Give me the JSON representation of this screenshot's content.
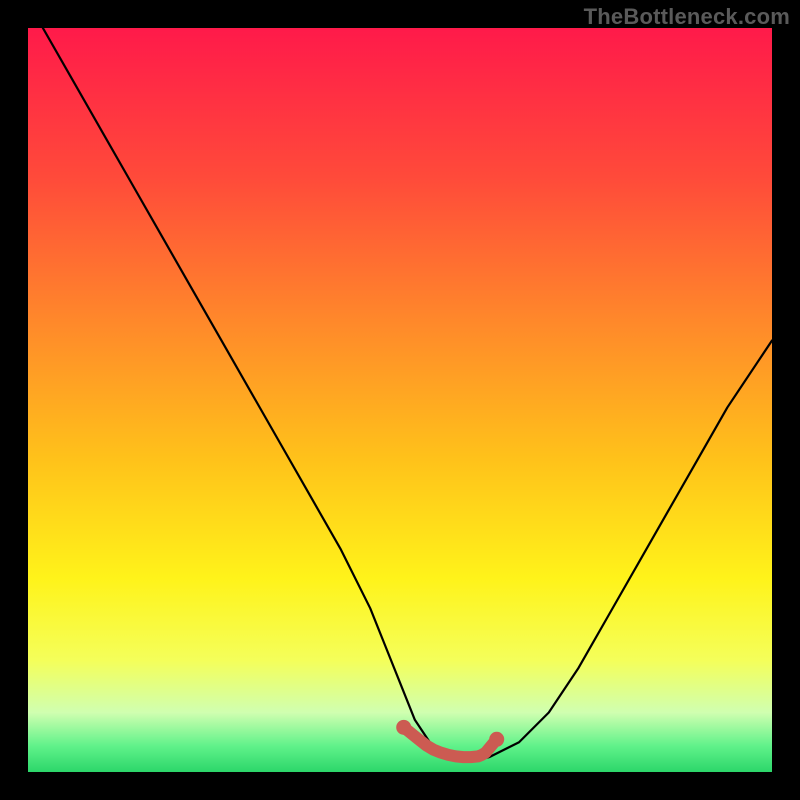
{
  "watermark": "TheBottleneck.com",
  "chart_data": {
    "type": "line",
    "title": "",
    "xlabel": "",
    "ylabel": "",
    "xlim": [
      0,
      100
    ],
    "ylim": [
      0,
      100
    ],
    "grid": false,
    "line_color": "#000000",
    "marker_color": "#cc5b52",
    "gradient_stops": [
      {
        "offset": 0.0,
        "color": "#ff1a4a"
      },
      {
        "offset": 0.2,
        "color": "#ff4a3a"
      },
      {
        "offset": 0.4,
        "color": "#ff8a2a"
      },
      {
        "offset": 0.58,
        "color": "#ffc21a"
      },
      {
        "offset": 0.74,
        "color": "#fff31a"
      },
      {
        "offset": 0.85,
        "color": "#f4ff5a"
      },
      {
        "offset": 0.92,
        "color": "#d0ffb0"
      },
      {
        "offset": 0.965,
        "color": "#60f28a"
      },
      {
        "offset": 1.0,
        "color": "#2cd66a"
      }
    ],
    "series": [
      {
        "name": "curve",
        "x": [
          2,
          6,
          10,
          14,
          18,
          22,
          26,
          30,
          34,
          38,
          42,
          46,
          50,
          52,
          54,
          56,
          58,
          60,
          62,
          66,
          70,
          74,
          78,
          82,
          86,
          90,
          94,
          98,
          100
        ],
        "y": [
          100,
          93,
          86,
          79,
          72,
          65,
          58,
          51,
          44,
          37,
          30,
          22,
          12,
          7,
          4,
          2,
          1.5,
          1.5,
          2,
          4,
          8,
          14,
          21,
          28,
          35,
          42,
          49,
          55,
          58
        ]
      }
    ],
    "flat_segment": {
      "x": [
        50.5,
        51.5,
        52.5,
        53.5,
        54.5,
        55.5,
        56.5,
        57.5,
        58.5,
        59.5,
        60.5,
        61.0,
        61.5,
        62.0,
        63.0
      ],
      "y": [
        6.0,
        5.2,
        4.4,
        3.6,
        3.0,
        2.6,
        2.3,
        2.1,
        2.0,
        2.0,
        2.1,
        2.3,
        2.6,
        3.2,
        4.4
      ]
    }
  }
}
